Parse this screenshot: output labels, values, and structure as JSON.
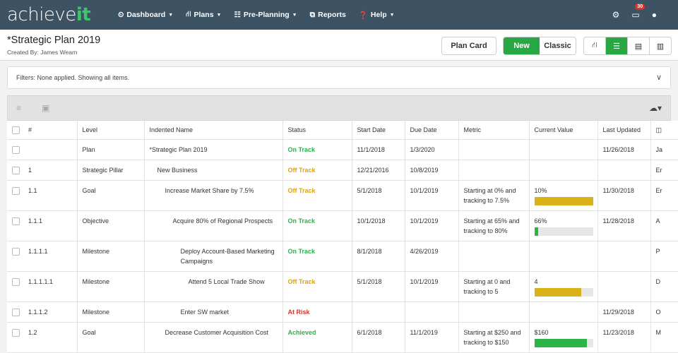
{
  "app": {
    "logo_main": "achieve",
    "logo_accent": "it",
    "nav": [
      {
        "label": "Dashboard",
        "icon": "dashboard-icon",
        "glyph": "⏲",
        "caret": true
      },
      {
        "label": "Plans",
        "icon": "sitemap-icon",
        "glyph": "⛙",
        "caret": true
      },
      {
        "label": "Pre-Planning",
        "icon": "people-icon",
        "glyph": "☷",
        "caret": true
      },
      {
        "label": "Reports",
        "icon": "reports-icon",
        "glyph": "⧉",
        "caret": false
      },
      {
        "label": "Help",
        "icon": "help-icon",
        "glyph": "❓",
        "caret": true
      }
    ],
    "notification_count": "30"
  },
  "plan": {
    "title": "*Strategic Plan 2019",
    "created_by": "Created By: James Wearn",
    "plan_card_label": "Plan Card",
    "new_label": "New",
    "classic_label": "Classic"
  },
  "filters": {
    "label": "Filters:",
    "text": "None applied. Showing all items."
  },
  "table": {
    "columns": [
      "#",
      "Level",
      "Indented Name",
      "Status",
      "Start Date",
      "Due Date",
      "Metric",
      "Current Value",
      "Last Updated"
    ],
    "rows": [
      {
        "num": "",
        "level": "Plan",
        "name": "*Strategic Plan 2019",
        "indent": 0,
        "status": "On Track",
        "status_class": "st-on",
        "start": "11/1/2018",
        "due": "1/3/2020",
        "metric": "",
        "value": "",
        "progress": null,
        "bar_color": "",
        "updated": "11/26/2018",
        "owner": "Ja"
      },
      {
        "num": "1",
        "level": "Strategic Pillar",
        "name": "New Business",
        "indent": 1,
        "status": "Off Track",
        "status_class": "st-off",
        "start": "12/21/2016",
        "due": "10/8/2019",
        "metric": "",
        "value": "",
        "progress": null,
        "bar_color": "",
        "updated": "",
        "owner": "Er"
      },
      {
        "num": "1.1",
        "level": "Goal",
        "name": "Increase Market Share by 7.5%",
        "indent": 2,
        "status": "Off Track",
        "status_class": "st-off",
        "start": "5/1/2018",
        "due": "10/1/2019",
        "metric": "Starting at 0% and tracking to 7.5%",
        "value": "10%",
        "progress": 1.0,
        "bar_color": "#d9b21a",
        "updated": "11/30/2018",
        "owner": "Er"
      },
      {
        "num": "1.1.1",
        "level": "Objective",
        "name": "Acquire 80% of Regional Prospects",
        "indent": 3,
        "status": "On Track",
        "status_class": "st-on",
        "start": "10/1/2018",
        "due": "10/1/2019",
        "metric": "Starting at 65% and tracking to 80%",
        "value": "66%",
        "progress": 0.07,
        "bar_color": "#2cb34a",
        "updated": "11/28/2018",
        "owner": "A"
      },
      {
        "num": "1.1.1.1",
        "level": "Milestone",
        "name": "Deploy Account-Based Marketing Campaigns",
        "indent": 4,
        "status": "On Track",
        "status_class": "st-on",
        "start": "8/1/2018",
        "due": "4/26/2019",
        "metric": "",
        "value": "",
        "progress": null,
        "bar_color": "",
        "updated": "",
        "owner": "P"
      },
      {
        "num": "1.1.1.1.1",
        "level": "Milestone",
        "name": "Attend 5 Local Trade Show",
        "indent": 5,
        "status": "Off Track",
        "status_class": "st-off",
        "start": "5/1/2018",
        "due": "10/1/2019",
        "metric": "Starting at 0 and tracking to 5",
        "value": "4",
        "progress": 0.8,
        "bar_color": "#d9b21a",
        "updated": "",
        "owner": "D"
      },
      {
        "num": "1.1.1.2",
        "level": "Milestone",
        "name": "Enter SW market",
        "indent": 4,
        "status": "At Risk",
        "status_class": "st-risk",
        "start": "",
        "due": "",
        "metric": "",
        "value": "",
        "progress": null,
        "bar_color": "",
        "updated": "11/29/2018",
        "owner": "O"
      },
      {
        "num": "1.2",
        "level": "Goal",
        "name": "Decrease Customer Acquisition Cost",
        "indent": 2,
        "status": "Achieved",
        "status_class": "st-ach",
        "start": "6/1/2018",
        "due": "11/1/2019",
        "metric": "Starting at $250 and tracking to $150",
        "value": "$160",
        "progress": 0.9,
        "bar_color": "#2cb34a",
        "updated": "11/23/2018",
        "owner": "M"
      }
    ]
  }
}
